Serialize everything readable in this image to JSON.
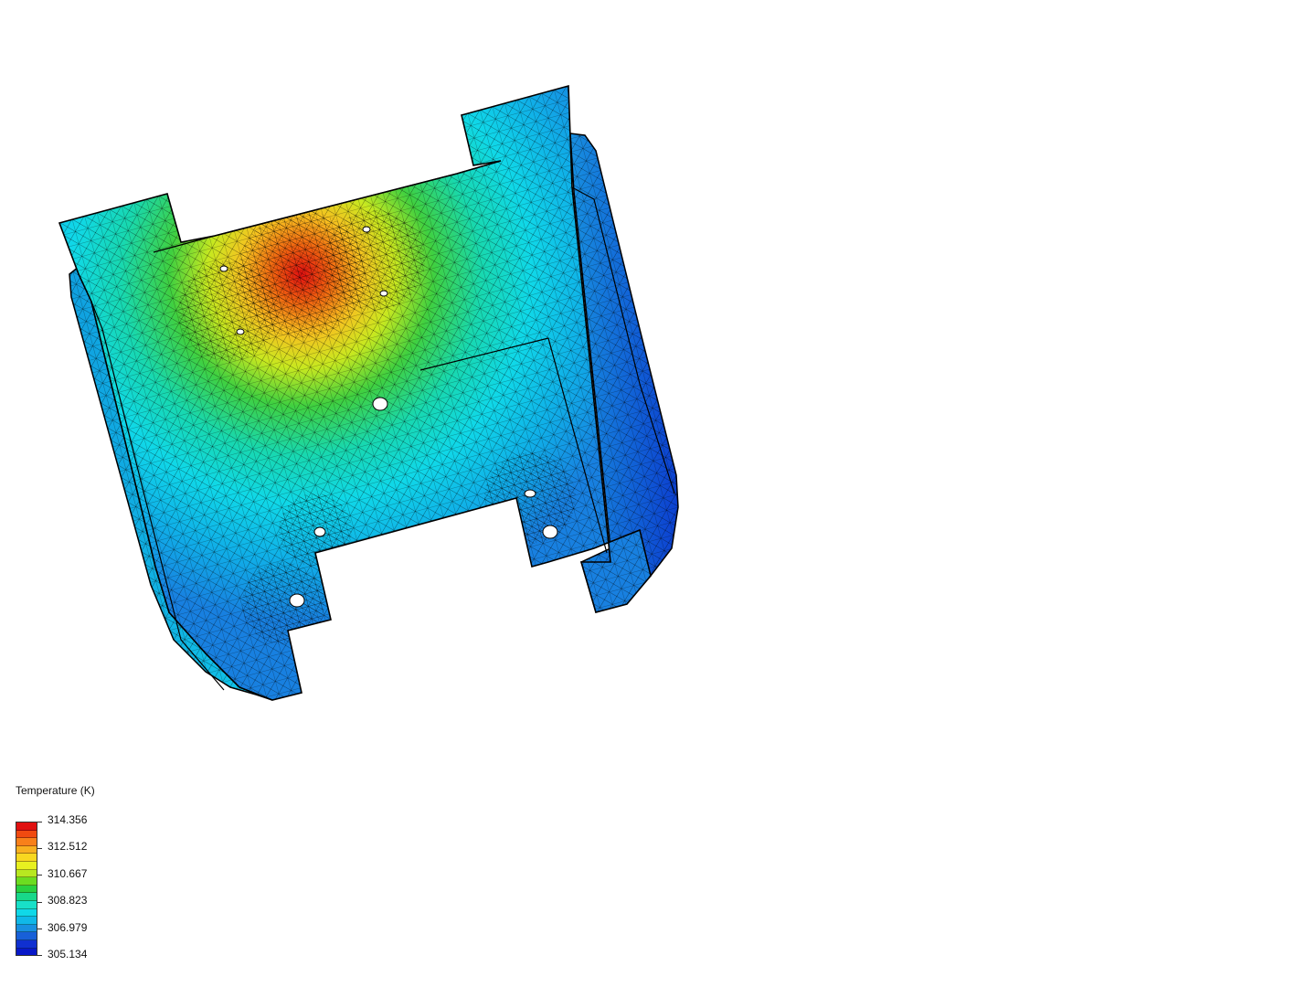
{
  "legend": {
    "title": "Temperature (K)",
    "ticks": [
      "314.356",
      "312.512",
      "310.667",
      "308.823",
      "306.979",
      "305.134"
    ],
    "band_colors": [
      "#e01010",
      "#f04a10",
      "#f8801a",
      "#f8b020",
      "#f8d820",
      "#e8f020",
      "#b8e820",
      "#6cdc20",
      "#28d040",
      "#18d88a",
      "#18e0c8",
      "#10d8e8",
      "#10b8e8",
      "#1890e0",
      "#1860d8",
      "#1030d0",
      "#0818c8"
    ]
  },
  "model": {
    "description_icon": "fea-mesh-model",
    "colors": {
      "hot": "#e01a10",
      "warm": "#f0c020",
      "mid": "#40d040",
      "cool": "#10d8e8",
      "cold": "#1050d0"
    }
  }
}
